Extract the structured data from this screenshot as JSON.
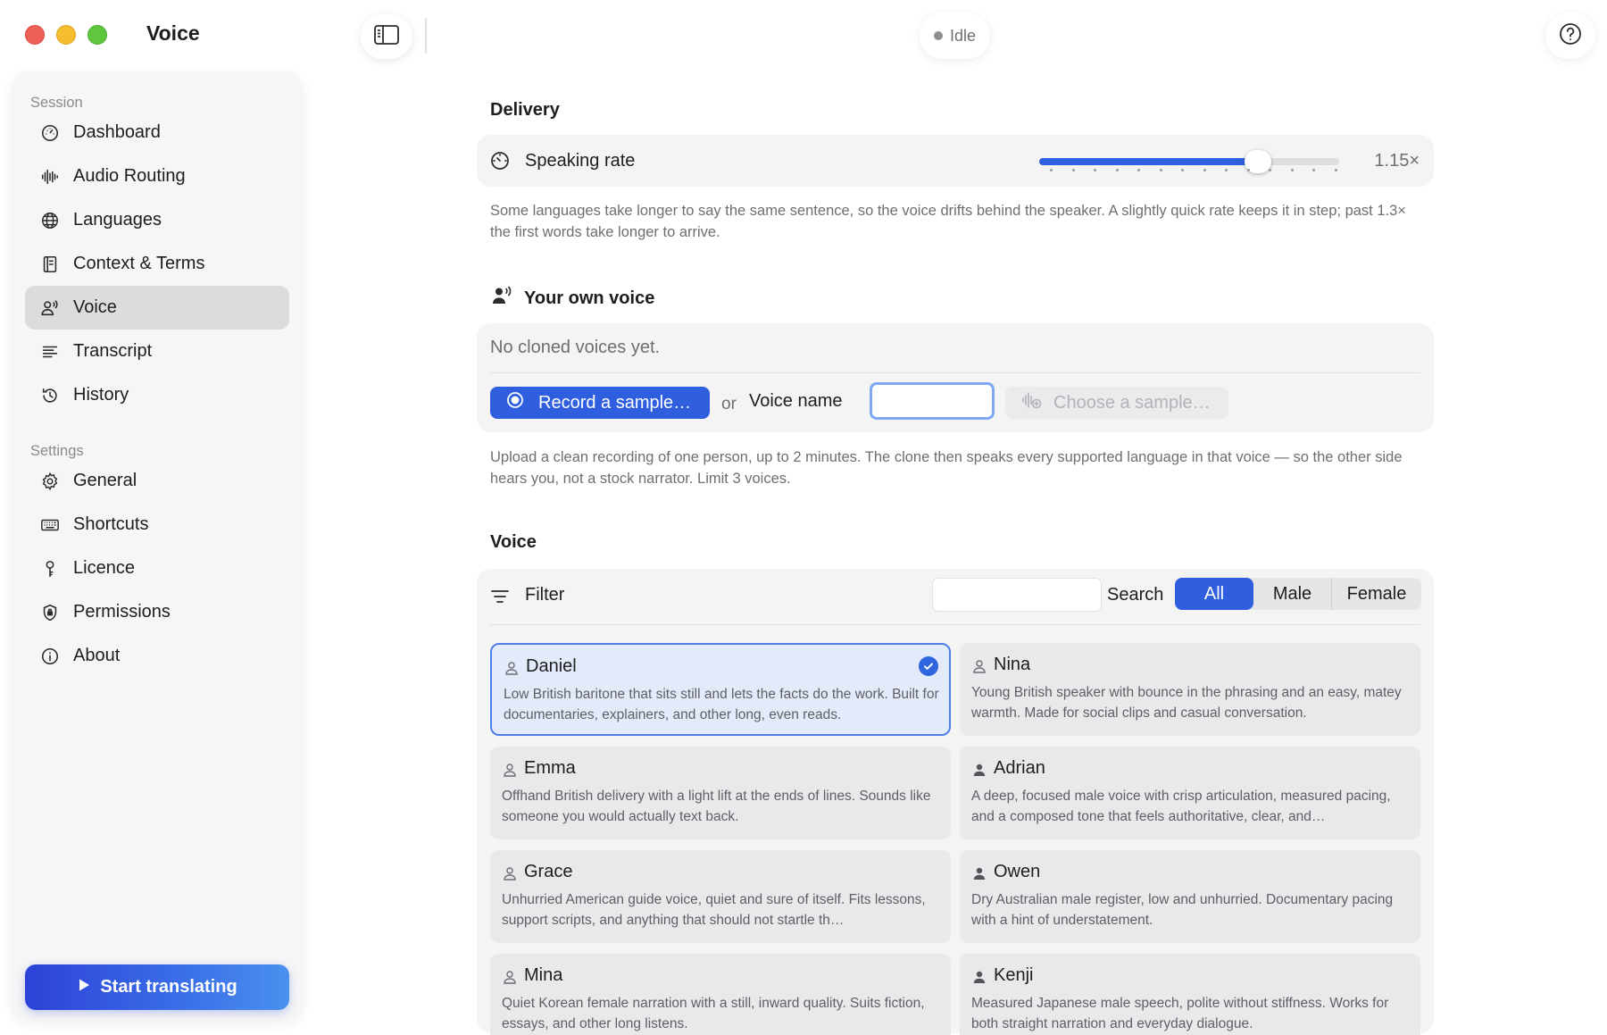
{
  "window": {
    "title": "Voice"
  },
  "sidebar": {
    "session_label": "Session",
    "settings_label": "Settings",
    "session_items": [
      {
        "label": "Dashboard",
        "icon": "gauge-icon"
      },
      {
        "label": "Audio Routing",
        "icon": "waveform-icon"
      },
      {
        "label": "Languages",
        "icon": "globe-icon"
      },
      {
        "label": "Context & Terms",
        "icon": "book-icon"
      },
      {
        "label": "Voice",
        "icon": "person-voice-icon",
        "active": true
      },
      {
        "label": "Transcript",
        "icon": "text-lines-icon"
      },
      {
        "label": "History",
        "icon": "clock-history-icon"
      }
    ],
    "settings_items": [
      {
        "label": "General",
        "icon": "gear-icon"
      },
      {
        "label": "Shortcuts",
        "icon": "keyboard-icon"
      },
      {
        "label": "Licence",
        "icon": "key-icon"
      },
      {
        "label": "Permissions",
        "icon": "shield-lock-icon"
      },
      {
        "label": "About",
        "icon": "info-icon"
      }
    ],
    "start_button": "Start translating"
  },
  "topbar": {
    "status": "Idle"
  },
  "delivery": {
    "title": "Delivery",
    "rate_label": "Speaking rate",
    "rate_value": "1.15×",
    "rate_fraction": 0.73,
    "hint": "Some languages take longer to say the same sentence, so the voice drifts behind the speaker. A slightly quick rate keeps it in step; past 1.3× the first words take longer to arrive."
  },
  "own_voice": {
    "title": "Your own voice",
    "empty": "No cloned voices yet.",
    "record_button": "Record a sample…",
    "or": "or",
    "voice_name_label": "Voice name",
    "voice_name_value": "",
    "choose_button": "Choose a sample…",
    "hint": "Upload a clean recording of one person, up to 2 minutes. The clone then speaks every supported language in that voice — so the other side hears you, not a stock narrator. Limit 3 voices."
  },
  "voices": {
    "title": "Voice",
    "filter_label": "Filter",
    "search_label": "Search",
    "search_value": "",
    "segments": [
      "All",
      "Male",
      "Female"
    ],
    "items": [
      {
        "name": "Daniel",
        "desc": "Low British baritone that sits still and lets the facts do the work. Built for documentaries, explainers, and other long, even reads.",
        "selected": true,
        "gender": "outline"
      },
      {
        "name": "Nina",
        "desc": "Young British speaker with bounce in the phrasing and an easy, matey warmth. Made for social clips and casual conversation.",
        "gender": "outline"
      },
      {
        "name": "Emma",
        "desc": "Offhand British delivery with a light lift at the ends of lines. Sounds like someone you would actually text back.",
        "gender": "outline"
      },
      {
        "name": "Adrian",
        "desc": "A deep, focused male voice with crisp articulation, measured pacing, and a composed tone that feels authoritative, clear, and…",
        "gender": "filled"
      },
      {
        "name": "Grace",
        "desc": "Unhurried American guide voice, quiet and sure of itself. Fits lessons, support scripts, and anything that should not startle th…",
        "gender": "outline"
      },
      {
        "name": "Owen",
        "desc": "Dry Australian male register, low and unhurried. Documentary pacing with a hint of understatement.",
        "gender": "filled"
      },
      {
        "name": "Mina",
        "desc": "Quiet Korean female narration with a still, inward quality. Suits fiction, essays, and other long listens.",
        "gender": "outline"
      },
      {
        "name": "Kenji",
        "desc": "Measured Japanese male speech, polite without stiffness. Works for both straight narration and everyday dialogue.",
        "gender": "filled"
      }
    ]
  },
  "colors": {
    "accent": "#2f5fde",
    "sidebar_bg": "#f6f6f6",
    "card_bg": "#f4f4f5"
  }
}
